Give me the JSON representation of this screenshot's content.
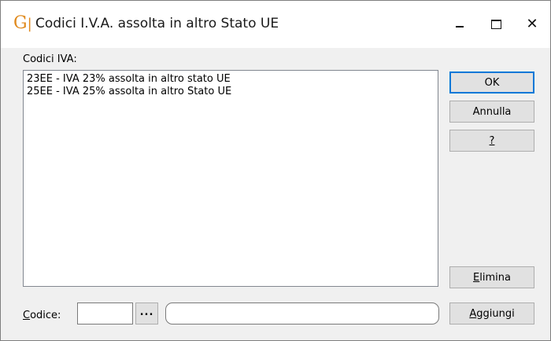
{
  "window": {
    "title": "Codici I.V.A. assolta in altro Stato UE",
    "app_icon": "G1",
    "controls": [
      "minimize-icon",
      "maximize-icon",
      "close-icon"
    ]
  },
  "list": {
    "label": "Codici IVA:",
    "items": [
      "23EE - IVA 23% assolta in altro stato UE",
      "25EE - IVA 25% assolta in altro Stato UE"
    ]
  },
  "buttons": {
    "ok": "OK",
    "annulla": "Annulla",
    "help": "?",
    "elimina_first": "E",
    "elimina_rest": "limina",
    "aggiungi_first": "A",
    "aggiungi_rest": "ggiungi",
    "browse": "..."
  },
  "codice": {
    "label_first": "C",
    "label_rest": "odice:",
    "value": "",
    "description": ""
  },
  "colors": {
    "focus_border": "#0078d7",
    "button_face": "#e1e1e1",
    "dialog_bg": "#f0f0f0",
    "icon_orange": "#e08a1e"
  }
}
